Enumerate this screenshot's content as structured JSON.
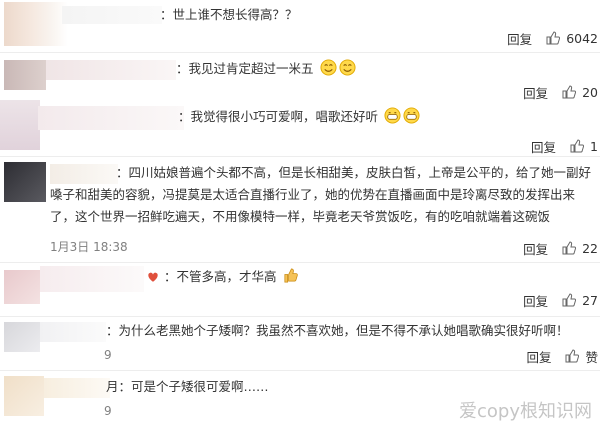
{
  "comments": [
    {
      "text": "：世上谁不想长得高？？",
      "reply": "回复",
      "likes": "6042"
    },
    {
      "text": "：我见过肯定超过一米五",
      "reply": "回复",
      "likes": "20"
    },
    {
      "text": "：我觉得很小巧可爱啊，唱歌还好听",
      "reply": "回复",
      "likes": "1"
    },
    {
      "name": "：四川姑娘普遍个头都不高，但是长相甜美，皮肤白皙，上帝是公平的，给了她一副好嗓子和甜美的容貌，冯提莫是太适合直播行业了，她的优势在直播画面中是玲离尽致的发挥出来了，这个世界一招鲜吃遍天，不用像模特一样，毕竟老天爷赏饭吃，有的吃咱就端着这碗饭",
      "time": "1月3日 18:38",
      "reply": "回复",
      "likes": "22"
    },
    {
      "text": "：不管多高，才华高",
      "reply": "回复",
      "likes": "27"
    },
    {
      "text": "：为什么老黑她个子矮啊？我虽然不喜欢她，但是不得不承认她唱歌确实很好听啊！",
      "time": "9",
      "reply": "回复",
      "likes": "赞"
    },
    {
      "text": "月：可是个子矮很可爱啊……",
      "time": "9"
    }
  ],
  "watermark": "爱copy根知识网"
}
